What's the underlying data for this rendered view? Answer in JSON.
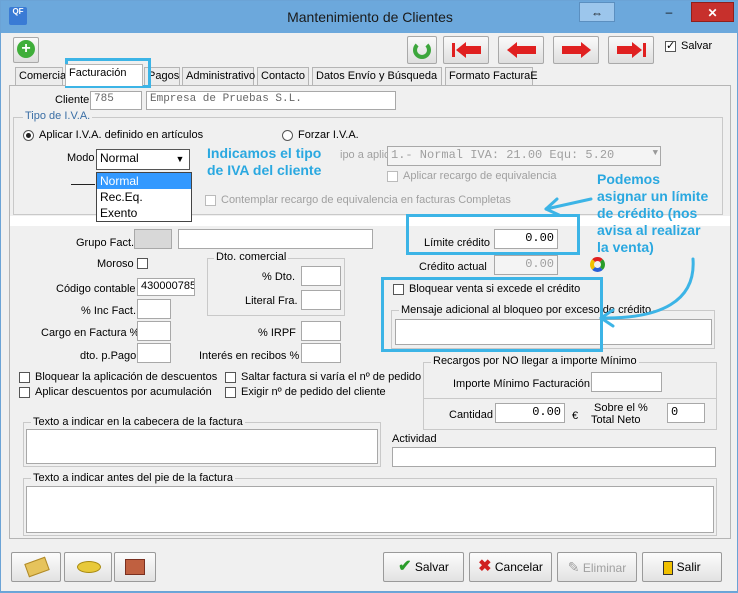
{
  "window": {
    "title": "Mantenimiento de Clientes",
    "app_badge": "QF",
    "restore_glyph": "⇔",
    "minimize_glyph": "–",
    "close_glyph": "✕"
  },
  "toolbar": {
    "salvar_label": "Salvar",
    "salvar_checked": true
  },
  "tabs": [
    "Comercial",
    "Facturación",
    "Pagos",
    "Administrativo",
    "Contacto",
    "Datos Envío y Búsqueda",
    "Formato FacturaE"
  ],
  "active_tab": "Facturación",
  "cliente": {
    "label": "Cliente",
    "code": "785",
    "name": "Empresa de Pruebas S.L."
  },
  "iva": {
    "group_title": "Tipo de I.V.A.",
    "aplicar_label": "Aplicar I.V.A. definido en artículos",
    "forzar_label": "Forzar I.V.A.",
    "modo_label": "Modo",
    "modo_value": "Normal",
    "modo_options": [
      "Normal",
      "Rec.Eq.",
      "Exento"
    ],
    "tipo_label": "Tipo a aplicar",
    "tipo_label_visible": "ipo a aplicar",
    "tipo_value": "1.- Normal  IVA: 21.00  Equ: 5.20",
    "aplicar_recargo_label": "Aplicar recargo de equivalencia",
    "contemplar_label": "Contemplar recargo de equivalencia en facturas Completas"
  },
  "fields": {
    "grupo_fact": "Grupo Fact.",
    "moroso": "Moroso",
    "codigo_contable_label": "Código contable",
    "codigo_contable_value": "430000785",
    "inc_fact": "% Inc Fact.",
    "cargo_factura": "Cargo en Factura %",
    "dto_pago": "dto. p.Pago",
    "dto_comercial_title": "Dto. comercial",
    "pct_dto": "% Dto.",
    "literal_fra": "Literal Fra.",
    "irpf": "% IRPF",
    "interes_recibos": "Interés en recibos %",
    "limite_credito_label": "Límite crédito",
    "limite_credito_value": "0.00",
    "credito_actual_label": "Crédito actual",
    "credito_actual_value": "0.00",
    "bloquear_venta_label": "Bloquear venta si excede el crédito",
    "mensaje_bloqueo_label": "Mensaje adicional al bloqueo por exceso de crédito",
    "bloquear_descuentos": "Bloquear la aplicación de descuentos",
    "aplicar_acumulacion": "Aplicar descuentos por acumulación",
    "saltar_factura": "Saltar factura si varía el nº de pedido",
    "exigir_pedido": "Exigir nº de pedido del cliente",
    "recargos_title": "Recargos por NO llegar a importe Mínimo",
    "importe_minimo": "Importe Mínimo Facturación",
    "cantidad_label": "Cantidad",
    "cantidad_value": "0.00",
    "currency": "€",
    "sobre_el_label": "Sobre el %",
    "total_neto_label": "Total Neto",
    "sobre_value": "0",
    "texto_cabecera": "Texto a indicar en la cabecera de la factura",
    "actividad": "Actividad",
    "texto_pie": "Texto a indicar antes del pie de la factura"
  },
  "annotations": {
    "iva_note_line1": "Indicamos el tipo",
    "iva_note_line2": "de IVA del cliente",
    "credit_note_line1": "Podemos",
    "credit_note_line2": "asignar un límite",
    "credit_note_line3": "de crédito (nos",
    "credit_note_line4": "avisa al realizar",
    "credit_note_line5": "la venta)",
    "color": "#2aa8e0"
  },
  "buttons": {
    "salvar": "Salvar",
    "cancelar": "Cancelar",
    "eliminar": "Eliminar",
    "salir": "Salir"
  }
}
